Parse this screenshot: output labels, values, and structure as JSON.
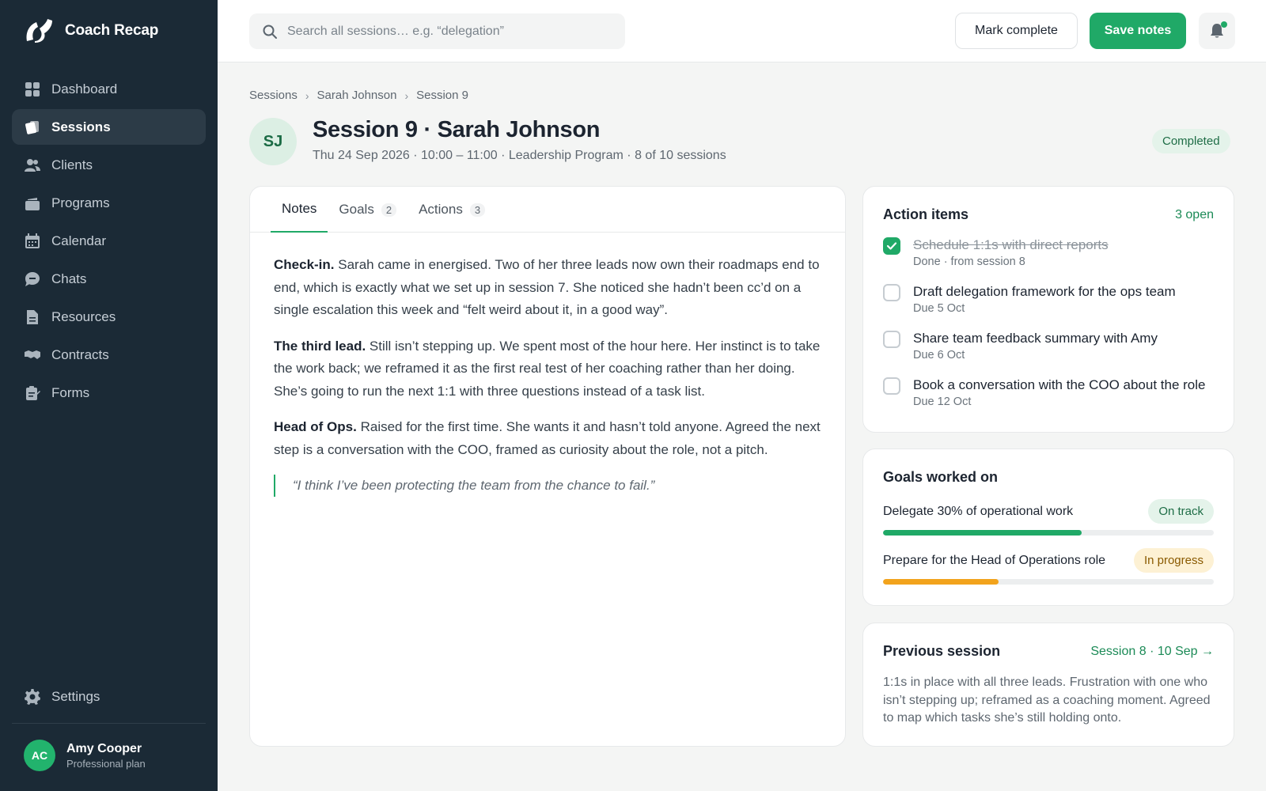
{
  "app": {
    "name": "Coach Recap"
  },
  "sidebar": {
    "items": [
      {
        "label": "Dashboard",
        "icon": "dashboard-icon"
      },
      {
        "label": "Sessions",
        "icon": "sessions-icon",
        "active": true
      },
      {
        "label": "Clients",
        "icon": "clients-icon"
      },
      {
        "label": "Programs",
        "icon": "programs-icon"
      },
      {
        "label": "Calendar",
        "icon": "calendar-icon"
      },
      {
        "label": "Chats",
        "icon": "chat-icon"
      },
      {
        "label": "Resources",
        "icon": "document-icon"
      },
      {
        "label": "Contracts",
        "icon": "handshake-icon"
      },
      {
        "label": "Forms",
        "icon": "clipboard-icon"
      }
    ],
    "settings_label": "Settings",
    "user": {
      "initials": "AC",
      "name": "Amy Cooper",
      "plan": "Professional plan"
    }
  },
  "topbar": {
    "search_placeholder": "Search all sessions… e.g. “delegation”",
    "search_value": "",
    "mark_complete_label": "Mark complete",
    "save_label": "Save notes"
  },
  "breadcrumb": [
    "Sessions",
    "Sarah Johnson",
    "Session 9"
  ],
  "header": {
    "initials": "SJ",
    "title": "Session 9 · Sarah Johnson",
    "meta": "Thu 24 Sep 2026 · 10:00 – 11:00 · Leadership Program · 8 of 10 sessions",
    "status": "Completed"
  },
  "tabs": [
    {
      "label": "Notes",
      "count": ""
    },
    {
      "label": "Goals",
      "count": "2"
    },
    {
      "label": "Actions",
      "count": "3"
    }
  ],
  "notes": {
    "paragraphs": [
      {
        "lead": "Check-in.",
        "text": " Sarah came in energised. Two of her three leads now own their roadmaps end to end, which is exactly what we set up in session 7. She noticed she hadn’t been cc’d on a single escalation this week and “felt weird about it, in a good way”."
      },
      {
        "lead": "The third lead.",
        "text": " Still isn’t stepping up. We spent most of the hour here. Her instinct is to take the work back; we reframed it as the first real test of her coaching rather than her doing. She’s going to run the next 1:1 with three questions instead of a task list."
      },
      {
        "lead": "Head of Ops.",
        "text": " Raised for the first time. She wants it and hasn’t told anyone. Agreed the next step is a conversation with the COO, framed as curiosity about the role, not a pitch."
      }
    ],
    "quote": "“I think I’ve been protecting the team from the chance to fail.”"
  },
  "action_items": {
    "title": "Action items",
    "open_count": "3 open",
    "items": [
      {
        "title": "Schedule 1:1s with direct reports",
        "sub": "Done · from session 8",
        "done": true
      },
      {
        "title": "Draft delegation framework for the ops team",
        "sub": "Due 5 Oct",
        "done": false
      },
      {
        "title": "Share team feedback summary with Amy",
        "sub": "Due 6 Oct",
        "done": false
      },
      {
        "title": "Book a conversation with the COO about the role",
        "sub": "Due 12 Oct",
        "done": false
      }
    ]
  },
  "goals": {
    "title": "Goals worked on",
    "items": [
      {
        "label": "Delegate 30% of operational work",
        "status": "On track",
        "progress": 0.6,
        "color": "#20a967"
      },
      {
        "label": "Prepare for the Head of Operations role",
        "status": "In progress",
        "progress": 0.35,
        "color": "#f2a31c"
      }
    ]
  },
  "previous": {
    "title": "Previous session",
    "link": "Session 8 · 10 Sep →",
    "text": "1:1s in place with all three leads. Frustration with one who isn’t stepping up; reframed as a coaching moment. Agreed to map which tasks she’s still holding onto."
  }
}
